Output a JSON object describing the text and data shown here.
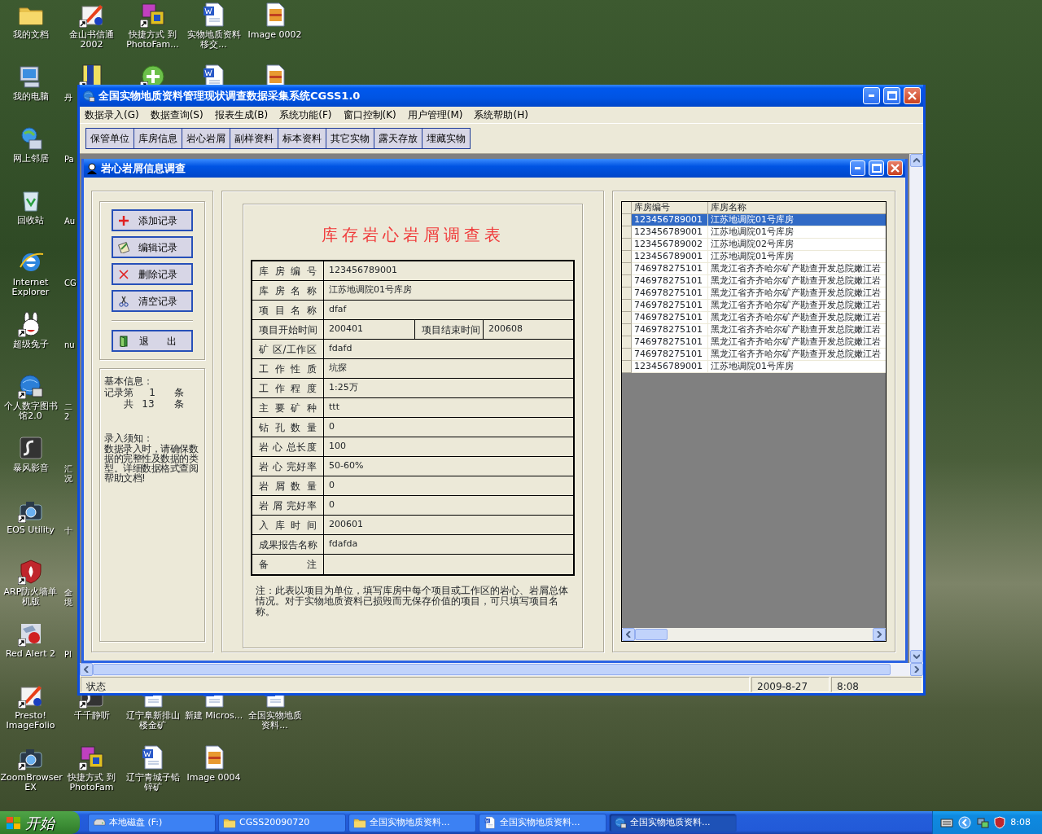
{
  "desktop": {
    "icon_columns": [
      {
        "top": [
          {
            "label": "我的文档",
            "kind": "folder",
            "shortcut": false,
            "cut": false
          },
          {
            "label": "我的电脑",
            "kind": "computer",
            "shortcut": false,
            "cut": false
          },
          {
            "label": "网上邻居",
            "kind": "network",
            "shortcut": false,
            "cut": false
          },
          {
            "label": "回收站",
            "kind": "recycle",
            "shortcut": false,
            "cut": false
          },
          {
            "label": "Internet Explorer",
            "kind": "browser",
            "shortcut": false,
            "cut": false
          },
          {
            "label": "超级兔子",
            "kind": "rabbit",
            "shortcut": true,
            "cut": false
          },
          {
            "label": "个人数字图书馆2.0",
            "kind": "globe",
            "shortcut": true,
            "cut": false
          },
          {
            "label": "暴风影音",
            "kind": "player",
            "shortcut": false,
            "cut": false
          },
          {
            "label": "EOS Utility",
            "kind": "camera",
            "shortcut": true,
            "cut": false
          },
          {
            "label": "ARP防火墙单机版",
            "kind": "shield",
            "shortcut": true,
            "cut": false
          },
          {
            "label": "Red Alert 2",
            "kind": "game",
            "shortcut": true,
            "cut": false
          },
          {
            "label": "Presto! ImageFolio",
            "kind": "paint",
            "shortcut": true,
            "cut": false
          },
          {
            "label": "ZoomBrowser EX",
            "kind": "camera",
            "shortcut": true,
            "cut": false
          }
        ]
      },
      {
        "top": [
          {
            "label": "金山书信通 2002",
            "kind": "paint",
            "shortcut": true,
            "cut": false
          },
          {
            "label": "丹",
            "kind": "book",
            "shortcut": true,
            "cut": true
          },
          {
            "label": "Pa",
            "cut": true
          },
          {
            "label": "Au",
            "cut": true
          },
          {
            "label": "CG",
            "cut": true
          },
          {
            "label": "nu",
            "cut": true
          },
          {
            "label": "二2",
            "cut": true
          },
          {
            "label": "汇况",
            "cut": true
          },
          {
            "label": "十",
            "cut": true
          },
          {
            "label": "全境",
            "cut": true
          },
          {
            "label": "Pl",
            "cut": true
          },
          {
            "label": "千千静听",
            "kind": "player",
            "shortcut": true,
            "cut": false
          },
          {
            "label": "快捷方式 到 PhotoFam",
            "kind": "frames",
            "shortcut": true,
            "cut": false
          }
        ]
      },
      {
        "top": [
          {
            "label": "快捷方式 到 PhotoFam...",
            "kind": "frames",
            "shortcut": true,
            "cut": false
          },
          {
            "kind": "plus",
            "shortcut": true
          }
        ],
        "bottom": [
          {
            "label": "辽宁阜新排山楼金矿",
            "kind": "word",
            "shortcut": false,
            "cut": false
          },
          {
            "label": "辽宁青城子铅锌矿",
            "kind": "word",
            "shortcut": false,
            "cut": false
          }
        ]
      },
      {
        "top": [
          {
            "label": "实物地质资料移交...",
            "kind": "word",
            "shortcut": false,
            "cut": false
          },
          {
            "kind": "word",
            "shortcut": false
          }
        ],
        "bottom": [
          {
            "label": "新建 Micros...",
            "kind": "word",
            "shortcut": false,
            "cut": false
          },
          {
            "label": "Image 0004",
            "kind": "image",
            "shortcut": false,
            "cut": false
          }
        ]
      },
      {
        "top": [
          {
            "label": "Image 0002",
            "kind": "image",
            "shortcut": false,
            "cut": false
          },
          {
            "kind": "image",
            "shortcut": false
          }
        ],
        "bottom": [
          {
            "label": "全国实物地质资料...",
            "kind": "word",
            "shortcut": false,
            "cut": false
          }
        ]
      }
    ]
  },
  "window": {
    "title": "全国实物地质资料管理现状调查数据采集系统CGSS1.0",
    "menu": [
      "数据录入(G)",
      "数据查询(S)",
      "报表生成(B)",
      "系统功能(F)",
      "窗口控制(K)",
      "用户管理(M)",
      "系统帮助(H)"
    ],
    "toolbar": [
      "保管单位",
      "库房信息",
      "岩心岩屑",
      "副样资料",
      "标本资料",
      "其它实物",
      "露天存放",
      "埋藏实物"
    ],
    "status_bar": {
      "label": "状态",
      "date": "2009-8-27",
      "time": "8:08"
    }
  },
  "child_window": {
    "title": "岩心岩屑信息调查",
    "actions": [
      {
        "label": "添加记录",
        "kind": "add"
      },
      {
        "label": "编辑记录",
        "kind": "edit"
      },
      {
        "label": "删除记录",
        "kind": "delete"
      },
      {
        "label": "清空记录",
        "kind": "clear"
      }
    ],
    "exit": {
      "label": "退      出",
      "kind": "exit"
    },
    "info": {
      "heading": "基本信息：",
      "record_label": "记录第",
      "record_number": "1",
      "record_unit": "条",
      "total_label": "共",
      "total_number": "13",
      "total_unit": "条",
      "notice_heading": "录入须知：",
      "notice": "数据录入时，请确保数据的完整性及数据的类型。详细数据格式查阅帮助文档!"
    },
    "form": {
      "title": "库存岩心岩屑调查表",
      "rows": [
        {
          "kind": "single",
          "label": "库 房 编 号",
          "value": "123456789001"
        },
        {
          "kind": "single",
          "label": "库 房 名 称",
          "value": "江苏地调院01号库房"
        },
        {
          "kind": "single",
          "label": "项 目 名 称",
          "value": "dfaf"
        },
        {
          "kind": "pair",
          "label": "项目开始时间",
          "value": "200401",
          "label_2": "项目结束时间",
          "value_2": "200608"
        },
        {
          "kind": "single",
          "label": "矿 区/工作区",
          "value": "fdafd"
        },
        {
          "kind": "single",
          "label": "工 作 性 质",
          "value": "坑探"
        },
        {
          "kind": "single",
          "label": "工 作 程 度",
          "value": "1:25万"
        },
        {
          "kind": "single",
          "label": "主 要 矿 种",
          "value": "ttt"
        },
        {
          "kind": "single",
          "label": "钻 孔 数 量",
          "value": "0"
        },
        {
          "kind": "single",
          "label": "岩 心 总长度",
          "value": "100"
        },
        {
          "kind": "single",
          "label": "岩 心 完好率",
          "value": "50-60%"
        },
        {
          "kind": "single",
          "label": "岩 屑 数 量",
          "value": "0"
        },
        {
          "kind": "single",
          "label": "岩 屑 完好率",
          "value": "0"
        },
        {
          "kind": "single",
          "label": "入 库 时 间",
          "value": "200601"
        },
        {
          "kind": "single",
          "label": "成果报告名称",
          "value": "fdafda"
        },
        {
          "kind": "single",
          "label": "备 注"
        }
      ],
      "note": "注：此表以项目为单位，填写库房中每个项目或工作区的岩心、岩屑总体情况。对于实物地质资料已损毁而无保存价值的项目，可只填写项目名称。"
    },
    "grid": {
      "columns": [
        "库房编号",
        "库房名称"
      ],
      "rows": [
        {
          "cells": [
            "123456789001",
            "江苏地调院01号库房"
          ],
          "selected": true
        },
        {
          "cells": [
            "123456789001",
            "江苏地调院01号库房"
          ],
          "selected": false
        },
        {
          "cells": [
            "123456789002",
            "江苏地调院02号库房"
          ],
          "selected": false
        },
        {
          "cells": [
            "123456789001",
            "江苏地调院01号库房"
          ],
          "selected": false
        },
        {
          "cells": [
            "746978275101",
            "黑龙江省齐齐哈尔矿产勘查开发总院嫩江岩"
          ],
          "selected": false
        },
        {
          "cells": [
            "746978275101",
            "黑龙江省齐齐哈尔矿产勘查开发总院嫩江岩"
          ],
          "selected": false
        },
        {
          "cells": [
            "746978275101",
            "黑龙江省齐齐哈尔矿产勘查开发总院嫩江岩"
          ],
          "selected": false
        },
        {
          "cells": [
            "746978275101",
            "黑龙江省齐齐哈尔矿产勘查开发总院嫩江岩"
          ],
          "selected": false
        },
        {
          "cells": [
            "746978275101",
            "黑龙江省齐齐哈尔矿产勘查开发总院嫩江岩"
          ],
          "selected": false
        },
        {
          "cells": [
            "746978275101",
            "黑龙江省齐齐哈尔矿产勘查开发总院嫩江岩"
          ],
          "selected": false
        },
        {
          "cells": [
            "746978275101",
            "黑龙江省齐齐哈尔矿产勘查开发总院嫩江岩"
          ],
          "selected": false
        },
        {
          "cells": [
            "746978275101",
            "黑龙江省齐齐哈尔矿产勘查开发总院嫩江岩"
          ],
          "selected": false
        },
        {
          "cells": [
            "123456789001",
            "江苏地调院01号库房"
          ],
          "selected": false
        }
      ]
    }
  },
  "taskbar": {
    "start": "开始",
    "tasks": [
      {
        "label": "本地磁盘 (F:)",
        "kind": "drive",
        "selected": false
      },
      {
        "label": "CGSS20090720",
        "kind": "folder",
        "selected": false
      },
      {
        "label": "全国实物地质资料...",
        "kind": "folder",
        "selected": false
      },
      {
        "label": "全国实物地质资料...",
        "kind": "word",
        "selected": false
      },
      {
        "label": "全国实物地质资料...",
        "kind": "globe",
        "selected": true
      }
    ],
    "clock": "8:08"
  }
}
